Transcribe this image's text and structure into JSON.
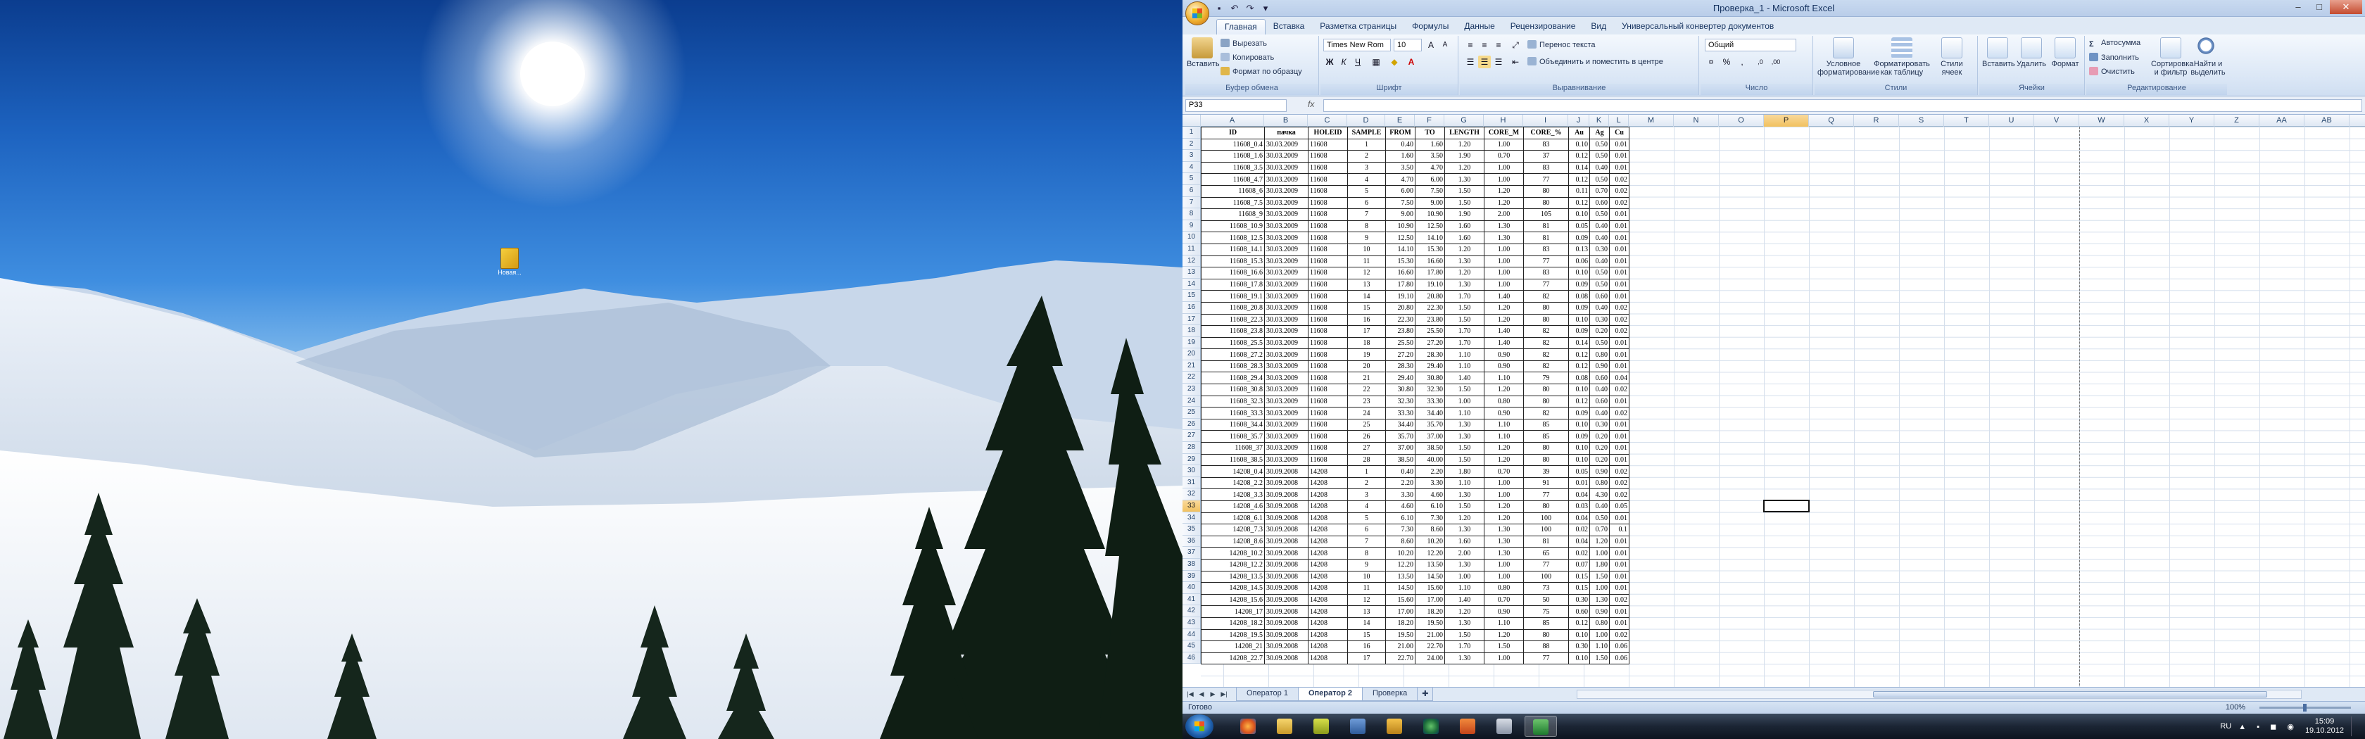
{
  "desktop": {
    "icon_label": "Новая..."
  },
  "excel": {
    "title": "Проверка_1 - Microsoft Excel",
    "tabs": [
      "Главная",
      "Вставка",
      "Разметка страницы",
      "Формулы",
      "Данные",
      "Рецензирование",
      "Вид",
      "Универсальный конвертер документов"
    ],
    "ribbon": {
      "clipboard": {
        "paste": "Вставить",
        "cut": "Вырезать",
        "copy": "Копировать",
        "format_painter": "Формат по образцу",
        "label": "Буфер обмена"
      },
      "font": {
        "name": "Times New Rom",
        "size": "10",
        "label": "Шрифт"
      },
      "alignment": {
        "wrap": "Перенос текста",
        "merge": "Объединить и поместить в центре",
        "label": "Выравнивание"
      },
      "number": {
        "format": "Общий",
        "label": "Число"
      },
      "styles": {
        "conditional": "Условное форматирование",
        "table": "Форматировать как таблицу",
        "cell_styles": "Стили ячеек",
        "label": "Стили"
      },
      "cells": {
        "insert": "Вставить",
        "delete": "Удалить",
        "format": "Формат",
        "label": "Ячейки"
      },
      "editing": {
        "autosum": "Автосумма",
        "fill": "Заполнить",
        "clear": "Очистить",
        "sort": "Сортировка и фильтр",
        "find": "Найти и выделить",
        "label": "Редактирование"
      }
    },
    "name_box": "P33",
    "fx": "fx",
    "columns": [
      "A",
      "B",
      "C",
      "D",
      "E",
      "F",
      "G",
      "H",
      "I",
      "J",
      "K",
      "L",
      "M",
      "N",
      "O",
      "P",
      "Q",
      "R",
      "S",
      "T",
      "U",
      "V",
      "W",
      "X",
      "Y",
      "Z",
      "AA",
      "AB",
      "AC"
    ],
    "selected_column": "P",
    "selected_row": 33,
    "table_headers": [
      "ID",
      "пачка",
      "HOLEID",
      "SAMPLE",
      "FROM",
      "TO",
      "LENGTH",
      "CORE_M",
      "CORE_%",
      "Au",
      "Ag",
      "Cu"
    ],
    "rows": [
      [
        "11608_0.4",
        "30.03.2009",
        "11608",
        "1",
        "0.40",
        "1.60",
        "1.20",
        "1.00",
        "83",
        "0.10",
        "0.50",
        "0.01"
      ],
      [
        "11608_1.6",
        "30.03.2009",
        "11608",
        "2",
        "1.60",
        "3.50",
        "1.90",
        "0.70",
        "37",
        "0.12",
        "0.50",
        "0.01"
      ],
      [
        "11608_3.5",
        "30.03.2009",
        "11608",
        "3",
        "3.50",
        "4.70",
        "1.20",
        "1.00",
        "83",
        "0.14",
        "0.40",
        "0.01"
      ],
      [
        "11608_4.7",
        "30.03.2009",
        "11608",
        "4",
        "4.70",
        "6.00",
        "1.30",
        "1.00",
        "77",
        "0.12",
        "0.50",
        "0.02"
      ],
      [
        "11608_6",
        "30.03.2009",
        "11608",
        "5",
        "6.00",
        "7.50",
        "1.50",
        "1.20",
        "80",
        "0.11",
        "0.70",
        "0.02"
      ],
      [
        "11608_7.5",
        "30.03.2009",
        "11608",
        "6",
        "7.50",
        "9.00",
        "1.50",
        "1.20",
        "80",
        "0.12",
        "0.60",
        "0.02"
      ],
      [
        "11608_9",
        "30.03.2009",
        "11608",
        "7",
        "9.00",
        "10.90",
        "1.90",
        "2.00",
        "105",
        "0.10",
        "0.50",
        "0.01"
      ],
      [
        "11608_10.9",
        "30.03.2009",
        "11608",
        "8",
        "10.90",
        "12.50",
        "1.60",
        "1.30",
        "81",
        "0.05",
        "0.40",
        "0.01"
      ],
      [
        "11608_12.5",
        "30.03.2009",
        "11608",
        "9",
        "12.50",
        "14.10",
        "1.60",
        "1.30",
        "81",
        "0.09",
        "0.40",
        "0.01"
      ],
      [
        "11608_14.1",
        "30.03.2009",
        "11608",
        "10",
        "14.10",
        "15.30",
        "1.20",
        "1.00",
        "83",
        "0.13",
        "0.30",
        "0.01"
      ],
      [
        "11608_15.3",
        "30.03.2009",
        "11608",
        "11",
        "15.30",
        "16.60",
        "1.30",
        "1.00",
        "77",
        "0.06",
        "0.40",
        "0.01"
      ],
      [
        "11608_16.6",
        "30.03.2009",
        "11608",
        "12",
        "16.60",
        "17.80",
        "1.20",
        "1.00",
        "83",
        "0.10",
        "0.50",
        "0.01"
      ],
      [
        "11608_17.8",
        "30.03.2009",
        "11608",
        "13",
        "17.80",
        "19.10",
        "1.30",
        "1.00",
        "77",
        "0.09",
        "0.50",
        "0.01"
      ],
      [
        "11608_19.1",
        "30.03.2009",
        "11608",
        "14",
        "19.10",
        "20.80",
        "1.70",
        "1.40",
        "82",
        "0.08",
        "0.60",
        "0.01"
      ],
      [
        "11608_20.8",
        "30.03.2009",
        "11608",
        "15",
        "20.80",
        "22.30",
        "1.50",
        "1.20",
        "80",
        "0.09",
        "0.40",
        "0.02"
      ],
      [
        "11608_22.3",
        "30.03.2009",
        "11608",
        "16",
        "22.30",
        "23.80",
        "1.50",
        "1.20",
        "80",
        "0.10",
        "0.30",
        "0.02"
      ],
      [
        "11608_23.8",
        "30.03.2009",
        "11608",
        "17",
        "23.80",
        "25.50",
        "1.70",
        "1.40",
        "82",
        "0.09",
        "0.20",
        "0.02"
      ],
      [
        "11608_25.5",
        "30.03.2009",
        "11608",
        "18",
        "25.50",
        "27.20",
        "1.70",
        "1.40",
        "82",
        "0.14",
        "0.50",
        "0.01"
      ],
      [
        "11608_27.2",
        "30.03.2009",
        "11608",
        "19",
        "27.20",
        "28.30",
        "1.10",
        "0.90",
        "82",
        "0.12",
        "0.80",
        "0.01"
      ],
      [
        "11608_28.3",
        "30.03.2009",
        "11608",
        "20",
        "28.30",
        "29.40",
        "1.10",
        "0.90",
        "82",
        "0.12",
        "0.90",
        "0.01"
      ],
      [
        "11608_29.4",
        "30.03.2009",
        "11608",
        "21",
        "29.40",
        "30.80",
        "1.40",
        "1.10",
        "79",
        "0.08",
        "0.60",
        "0.04"
      ],
      [
        "11608_30.8",
        "30.03.2009",
        "11608",
        "22",
        "30.80",
        "32.30",
        "1.50",
        "1.20",
        "80",
        "0.10",
        "0.40",
        "0.02"
      ],
      [
        "11608_32.3",
        "30.03.2009",
        "11608",
        "23",
        "32.30",
        "33.30",
        "1.00",
        "0.80",
        "80",
        "0.12",
        "0.60",
        "0.01"
      ],
      [
        "11608_33.3",
        "30.03.2009",
        "11608",
        "24",
        "33.30",
        "34.40",
        "1.10",
        "0.90",
        "82",
        "0.09",
        "0.40",
        "0.02"
      ],
      [
        "11608_34.4",
        "30.03.2009",
        "11608",
        "25",
        "34.40",
        "35.70",
        "1.30",
        "1.10",
        "85",
        "0.10",
        "0.30",
        "0.01"
      ],
      [
        "11608_35.7",
        "30.03.2009",
        "11608",
        "26",
        "35.70",
        "37.00",
        "1.30",
        "1.10",
        "85",
        "0.09",
        "0.20",
        "0.01"
      ],
      [
        "11608_37",
        "30.03.2009",
        "11608",
        "27",
        "37.00",
        "38.50",
        "1.50",
        "1.20",
        "80",
        "0.10",
        "0.20",
        "0.01"
      ],
      [
        "11608_38.5",
        "30.03.2009",
        "11608",
        "28",
        "38.50",
        "40.00",
        "1.50",
        "1.20",
        "80",
        "0.10",
        "0.20",
        "0.01"
      ],
      [
        "14208_0.4",
        "30.09.2008",
        "14208",
        "1",
        "0.40",
        "2.20",
        "1.80",
        "0.70",
        "39",
        "0.05",
        "0.90",
        "0.02"
      ],
      [
        "14208_2.2",
        "30.09.2008",
        "14208",
        "2",
        "2.20",
        "3.30",
        "1.10",
        "1.00",
        "91",
        "0.01",
        "0.80",
        "0.02"
      ],
      [
        "14208_3.3",
        "30.09.2008",
        "14208",
        "3",
        "3.30",
        "4.60",
        "1.30",
        "1.00",
        "77",
        "0.04",
        "4.30",
        "0.02"
      ],
      [
        "14208_4.6",
        "30.09.2008",
        "14208",
        "4",
        "4.60",
        "6.10",
        "1.50",
        "1.20",
        "80",
        "0.03",
        "0.40",
        "0.05"
      ],
      [
        "14208_6.1",
        "30.09.2008",
        "14208",
        "5",
        "6.10",
        "7.30",
        "1.20",
        "1.20",
        "100",
        "0.04",
        "0.50",
        "0.01"
      ],
      [
        "14208_7.3",
        "30.09.2008",
        "14208",
        "6",
        "7.30",
        "8.60",
        "1.30",
        "1.30",
        "100",
        "0.02",
        "0.70",
        "0.1"
      ],
      [
        "14208_8.6",
        "30.09.2008",
        "14208",
        "7",
        "8.60",
        "10.20",
        "1.60",
        "1.30",
        "81",
        "0.04",
        "1.20",
        "0.01"
      ],
      [
        "14208_10.2",
        "30.09.2008",
        "14208",
        "8",
        "10.20",
        "12.20",
        "2.00",
        "1.30",
        "65",
        "0.02",
        "1.00",
        "0.01"
      ],
      [
        "14208_12.2",
        "30.09.2008",
        "14208",
        "9",
        "12.20",
        "13.50",
        "1.30",
        "1.00",
        "77",
        "0.07",
        "1.80",
        "0.01"
      ],
      [
        "14208_13.5",
        "30.09.2008",
        "14208",
        "10",
        "13.50",
        "14.50",
        "1.00",
        "1.00",
        "100",
        "0.15",
        "1.50",
        "0.01"
      ],
      [
        "14208_14.5",
        "30.09.2008",
        "14208",
        "11",
        "14.50",
        "15.60",
        "1.10",
        "0.80",
        "73",
        "0.15",
        "1.00",
        "0.01"
      ],
      [
        "14208_15.6",
        "30.09.2008",
        "14208",
        "12",
        "15.60",
        "17.00",
        "1.40",
        "0.70",
        "50",
        "0.30",
        "1.30",
        "0.02"
      ],
      [
        "14208_17",
        "30.09.2008",
        "14208",
        "13",
        "17.00",
        "18.20",
        "1.20",
        "0.90",
        "75",
        "0.60",
        "0.90",
        "0.01"
      ],
      [
        "14208_18.2",
        "30.09.2008",
        "14208",
        "14",
        "18.20",
        "19.50",
        "1.30",
        "1.10",
        "85",
        "0.12",
        "0.80",
        "0.01"
      ],
      [
        "14208_19.5",
        "30.09.2008",
        "14208",
        "15",
        "19.50",
        "21.00",
        "1.50",
        "1.20",
        "80",
        "0.10",
        "1.00",
        "0.02"
      ],
      [
        "14208_21",
        "30.09.2008",
        "14208",
        "16",
        "21.00",
        "22.70",
        "1.70",
        "1.50",
        "88",
        "0.30",
        "1.10",
        "0.06"
      ],
      [
        "14208_22.7",
        "30.09.2008",
        "14208",
        "17",
        "22.70",
        "24.00",
        "1.30",
        "1.00",
        "77",
        "0.10",
        "1.50",
        "0.06"
      ]
    ],
    "sheets": [
      "Оператор 1",
      "Оператор 2",
      "Проверка"
    ],
    "active_sheet": "Оператор 2",
    "status": "Готово",
    "zoom": "100%"
  },
  "taskbar": {
    "lang": "RU",
    "time": "15:09",
    "date": "19.10.2012"
  }
}
